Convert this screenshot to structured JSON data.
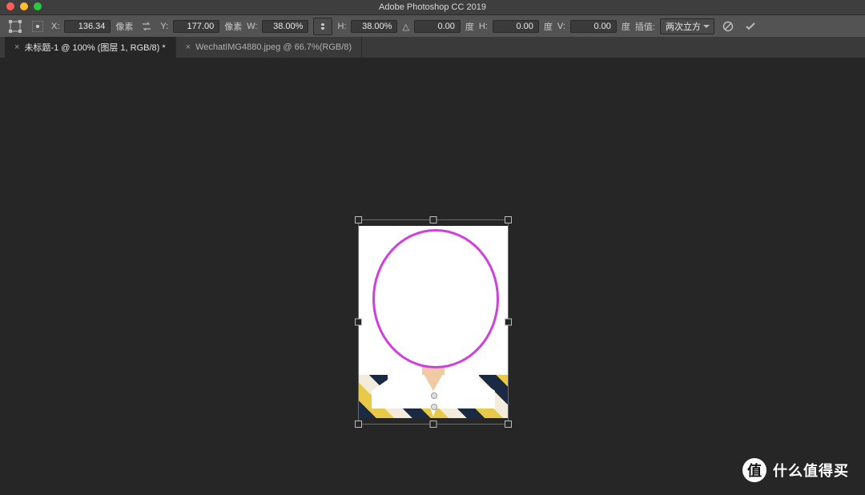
{
  "app": {
    "title": "Adobe Photoshop CC 2019"
  },
  "options": {
    "x_label": "X:",
    "x_value": "136.34",
    "x_unit": "像素",
    "y_label": "Y:",
    "y_value": "177.00",
    "y_unit": "像素",
    "w_label": "W:",
    "w_value": "38.00%",
    "h_label": "H:",
    "h_value": "38.00%",
    "angle_label": "△",
    "angle_value": "0.00",
    "deg_label": "度",
    "skew_h_label": "H:",
    "skew_h_value": "0.00",
    "skew_v_label": "V:",
    "skew_v_value": "0.00",
    "interp_label": "插值:",
    "interp_value": "两次立方"
  },
  "icons": {
    "transform_tool": "transform",
    "refpoint": "refpoint",
    "swap_xy": "swap",
    "link": "link",
    "cancel": "cancel",
    "commit": "commit"
  },
  "tabs": [
    {
      "label": "未标题-1 @ 100% (图层 1, RGB/8) *",
      "active": true
    },
    {
      "label": "WechatIMG4880.jpeg @ 66.7%(RGB/8)",
      "active": false
    }
  ],
  "watermark": {
    "badge": "值",
    "text": "什么值得买"
  }
}
